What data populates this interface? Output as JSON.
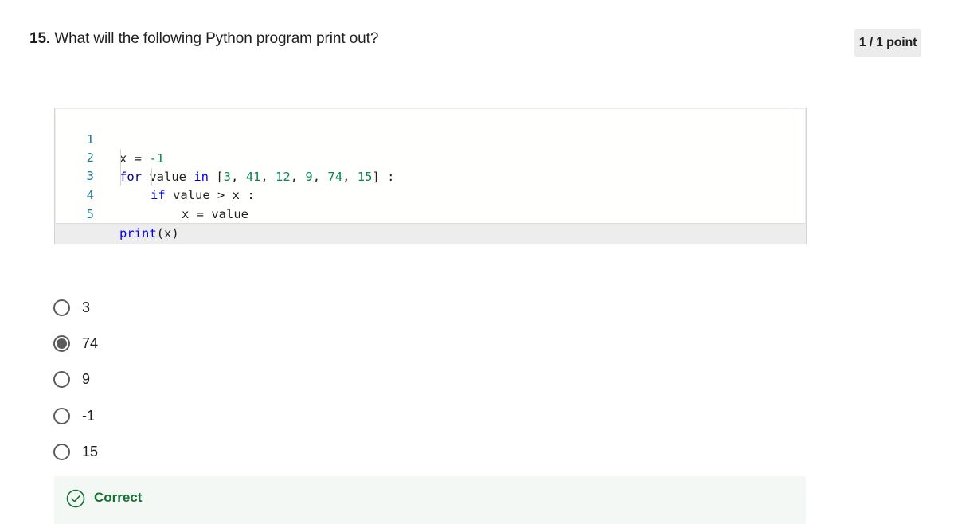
{
  "question": {
    "number": "15.",
    "text": "What will the following Python program print out?",
    "points": "1 / 1 point"
  },
  "code": {
    "line_numbers": [
      "1",
      "2",
      "3",
      "4",
      "5"
    ],
    "line1": {
      "a": "x = ",
      "b": "-1"
    },
    "line2": {
      "kw_for": "for",
      "t1": " value ",
      "kw_in": "in",
      "t2": " [",
      "n1": "3",
      "c1": ", ",
      "n2": "41",
      "c2": ", ",
      "n3": "12",
      "c3": ", ",
      "n4": "9",
      "c4": ", ",
      "n5": "74",
      "c5": ", ",
      "n6": "15",
      "t3": "] :"
    },
    "line3": {
      "kw_if": "if",
      "t1": " value > x :"
    },
    "line4": {
      "t1": "x = value"
    },
    "line5": {
      "fn": "print",
      "t1": "(x)"
    }
  },
  "options": [
    {
      "label": "3",
      "selected": false
    },
    {
      "label": "74",
      "selected": true
    },
    {
      "label": "9",
      "selected": false
    },
    {
      "label": "-1",
      "selected": false
    },
    {
      "label": "15",
      "selected": false
    }
  ],
  "feedback": {
    "label": "Correct",
    "icon": "check-circle-icon",
    "color": "#137333"
  }
}
